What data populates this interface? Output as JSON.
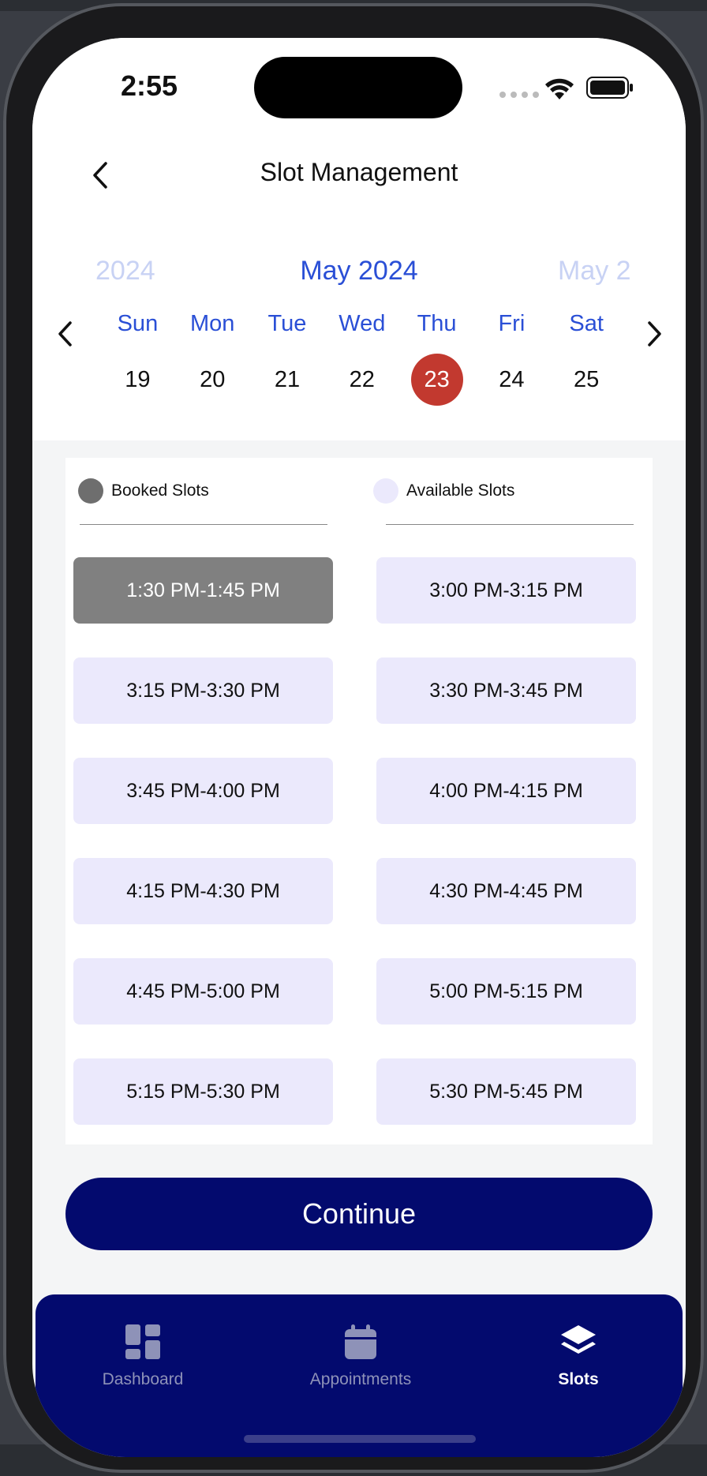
{
  "status_bar": {
    "time": "2:55"
  },
  "header": {
    "title": "Slot Management"
  },
  "calendar": {
    "prev_year_label": "2024",
    "current_label": "May 2024",
    "next_label": "May 2",
    "weekdays": [
      "Sun",
      "Mon",
      "Tue",
      "Wed",
      "Thu",
      "Fri",
      "Sat"
    ],
    "dates": [
      "19",
      "20",
      "21",
      "22",
      "23",
      "24",
      "25"
    ],
    "selected_date": "23"
  },
  "legend": {
    "booked_label": "Booked Slots",
    "available_label": "Available Slots"
  },
  "slots": [
    {
      "label": "1:30 PM-1:45 PM",
      "status": "booked"
    },
    {
      "label": "3:00 PM-3:15 PM",
      "status": "available"
    },
    {
      "label": "3:15 PM-3:30 PM",
      "status": "available"
    },
    {
      "label": "3:30 PM-3:45 PM",
      "status": "available"
    },
    {
      "label": "3:45 PM-4:00 PM",
      "status": "available"
    },
    {
      "label": "4:00 PM-4:15 PM",
      "status": "available"
    },
    {
      "label": "4:15 PM-4:30 PM",
      "status": "available"
    },
    {
      "label": "4:30 PM-4:45 PM",
      "status": "available"
    },
    {
      "label": "4:45 PM-5:00 PM",
      "status": "available"
    },
    {
      "label": "5:00 PM-5:15 PM",
      "status": "available"
    },
    {
      "label": "5:15 PM-5:30 PM",
      "status": "available"
    },
    {
      "label": "5:30 PM-5:45 PM",
      "status": "available"
    }
  ],
  "continue_label": "Continue",
  "nav": {
    "items": [
      {
        "label": "Dashboard",
        "icon": "dashboard-icon",
        "active": false
      },
      {
        "label": "Appointments",
        "icon": "calendar-icon",
        "active": false
      },
      {
        "label": "Slots",
        "icon": "layers-icon",
        "active": true
      }
    ]
  },
  "colors": {
    "primary": "#030a6e",
    "accent_blue": "#2a4fd6",
    "selected_date": "#c2392f",
    "booked_slot": "#808080",
    "available_slot": "#ebe9fc"
  }
}
